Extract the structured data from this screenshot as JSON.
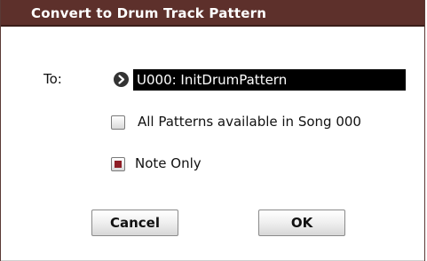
{
  "dialog": {
    "title": "Convert to Drum Track Pattern"
  },
  "to": {
    "label": "To:",
    "value": "U000: InitDrumPattern"
  },
  "options": {
    "all_patterns": {
      "label": "All Patterns available in Song 000",
      "checked": false
    },
    "note_only": {
      "label": "Note Only",
      "checked": true
    }
  },
  "buttons": {
    "cancel": "Cancel",
    "ok": "OK"
  },
  "colors": {
    "title_bar": "#5d302b",
    "field_bg": "#000000",
    "check_mark": "#8e1e26"
  }
}
